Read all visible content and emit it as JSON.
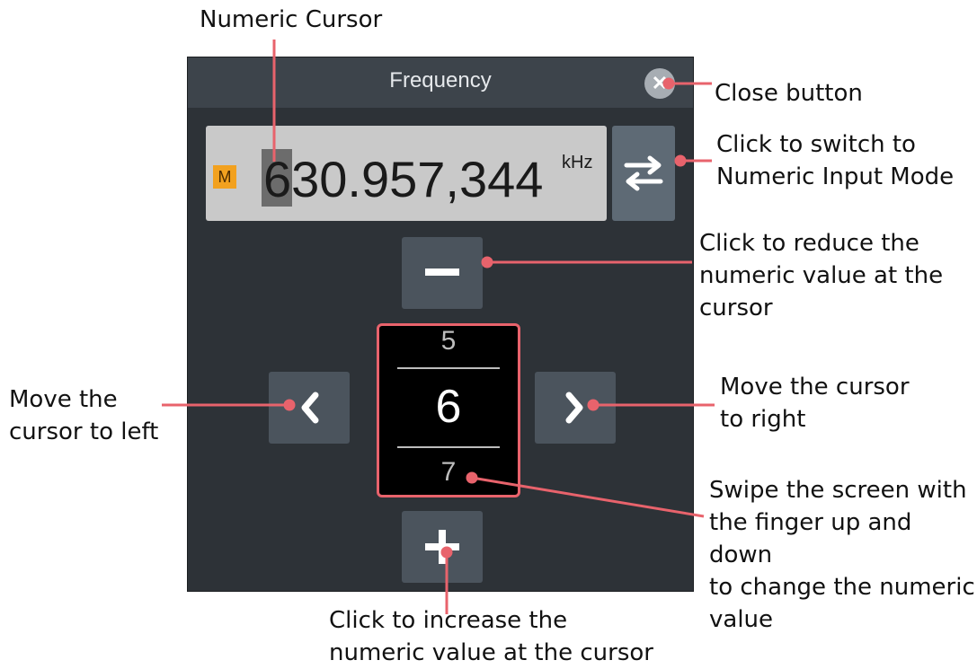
{
  "dialog": {
    "title": "Frequency",
    "close_glyph": "✕",
    "mode_badge": "M",
    "value": "630.957,344",
    "unit": "kHz",
    "wheel": {
      "prev_digit": "5",
      "current_digit": "6",
      "next_digit": "7"
    }
  },
  "annotations": {
    "numeric_cursor": "Numeric Cursor",
    "close_button": "Close button",
    "switch_mode_line1": "Click to switch to",
    "switch_mode_line2": "Numeric Input Mode",
    "reduce_line1": "Click to reduce the",
    "reduce_line2": "numeric value at the",
    "reduce_line3": "cursor",
    "move_left_line1": "Move the",
    "move_left_line2": "cursor to left",
    "move_right_line1": "Move the cursor",
    "move_right_line2": "to right",
    "swipe_line1": "Swipe the screen with",
    "swipe_line2": "the finger up and down",
    "swipe_line3": "to change the numeric",
    "swipe_line4": "value",
    "increase_line1": "Click to increase the",
    "increase_line2": "numeric value at the cursor"
  },
  "colors": {
    "dialog_bg": "#2d3237",
    "header_bg": "#3d444b",
    "button_bg": "#4b545d",
    "leader_line": "#e8636c",
    "mode_badge": "#f2a11f"
  },
  "icons": {
    "close": "close-icon",
    "mode_switch": "swap-arrows-icon",
    "decrease": "minus-icon",
    "increase": "plus-icon",
    "left": "chevron-left-icon",
    "right": "chevron-right-icon"
  }
}
